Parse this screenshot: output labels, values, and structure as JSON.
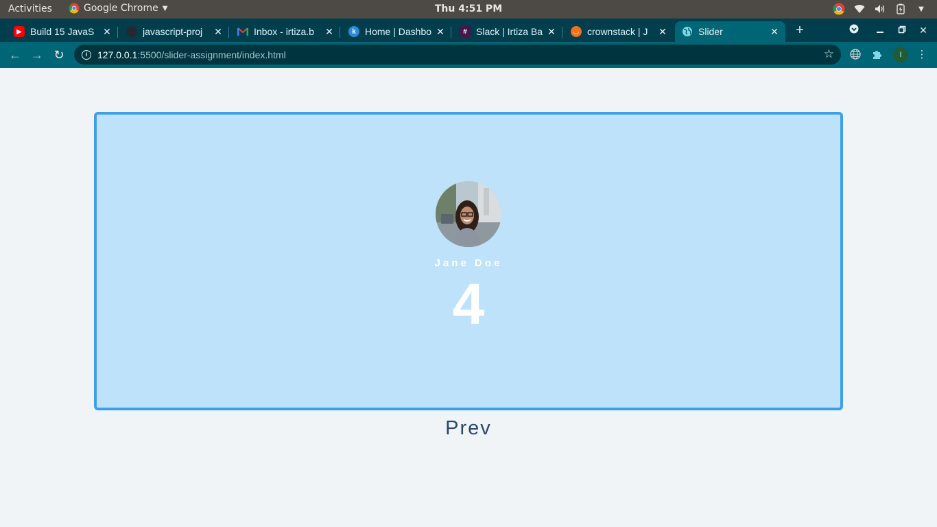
{
  "system": {
    "activities": "Activities",
    "app_name": "Google Chrome",
    "clock": "Thu  4:51 PM"
  },
  "browser": {
    "tabs": [
      {
        "title": "Build 15 JavaS",
        "icon": "youtube-icon",
        "color": "#ff0000"
      },
      {
        "title": "javascript-proj",
        "icon": "github-icon",
        "color": "#24292e"
      },
      {
        "title": "Inbox - irtiza.b",
        "icon": "gmail-icon",
        "color": "#ea4335"
      },
      {
        "title": "Home | Dashbo",
        "icon": "k-icon",
        "color": "#2a8bd9"
      },
      {
        "title": "Slack | Irtiza Ba",
        "icon": "slack-icon",
        "color": "#4a154b"
      },
      {
        "title": "crownstack | J",
        "icon": "crownstack-icon",
        "color": "#f2711c"
      },
      {
        "title": "Slider",
        "icon": "globe-icon",
        "color": "#1e88e5"
      }
    ],
    "url_host": "127.0.0.1",
    "url_path": ":5500/slider-assignment/index.html",
    "profile_initial": "I"
  },
  "slider": {
    "name": "Jane Doe",
    "number": "4"
  },
  "controls": {
    "prev_label": "Prev"
  },
  "colors": {
    "page_bg": "#f1f4f7",
    "slide_bg": "#bfe2fb",
    "slide_border": "#3f9fe6",
    "prev_text": "#2b4767"
  }
}
